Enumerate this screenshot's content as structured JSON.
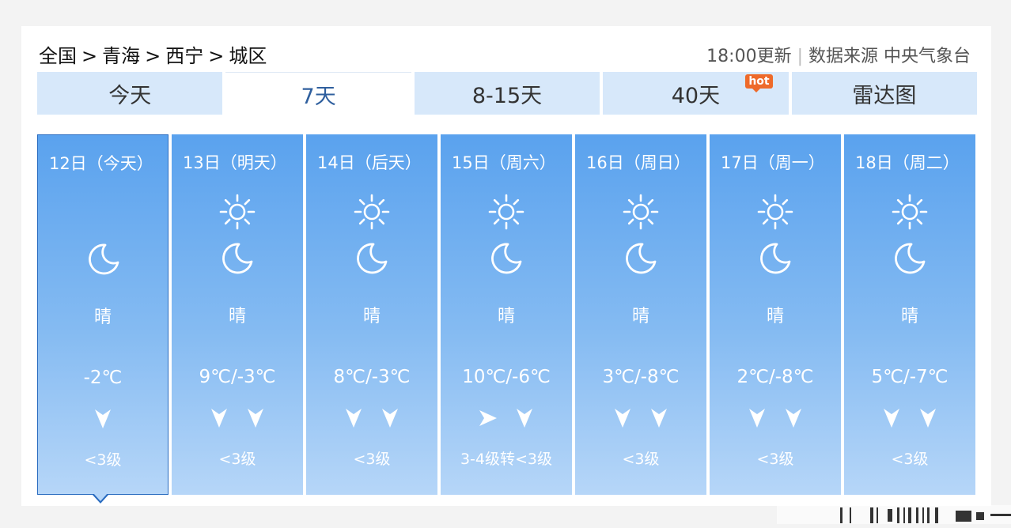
{
  "breadcrumb": {
    "items": [
      "全国",
      "青海",
      "西宁",
      "城区"
    ],
    "separator": ">"
  },
  "source": {
    "update_time": "18:00更新",
    "label": "数据来源 中央气象台"
  },
  "tabs": [
    {
      "label": "今天",
      "active": false
    },
    {
      "label": "7天",
      "active": true
    },
    {
      "label": "8-15天",
      "active": false
    },
    {
      "label": "40天",
      "active": false,
      "badge": "hot"
    },
    {
      "label": "雷达图",
      "active": false
    }
  ],
  "days": [
    {
      "date": "12日（今天）",
      "day_icon": null,
      "night_icon": "moon-icon",
      "condition": "晴",
      "temperature": "-2℃",
      "wind_dirs": [
        "down"
      ],
      "wind_level": "<3级",
      "selected": true
    },
    {
      "date": "13日（明天）",
      "day_icon": "sun-icon",
      "night_icon": "moon-icon",
      "condition": "晴",
      "temperature": "9℃/-3℃",
      "wind_dirs": [
        "down",
        "down"
      ],
      "wind_level": "<3级",
      "selected": false
    },
    {
      "date": "14日（后天）",
      "day_icon": "sun-icon",
      "night_icon": "moon-icon",
      "condition": "晴",
      "temperature": "8℃/-3℃",
      "wind_dirs": [
        "down",
        "down"
      ],
      "wind_level": "<3级",
      "selected": false
    },
    {
      "date": "15日（周六）",
      "day_icon": "sun-icon",
      "night_icon": "moon-icon",
      "condition": "晴",
      "temperature": "10℃/-6℃",
      "wind_dirs": [
        "right",
        "down"
      ],
      "wind_level": "3-4级转<3级",
      "selected": false
    },
    {
      "date": "16日（周日）",
      "day_icon": "sun-icon",
      "night_icon": "moon-icon",
      "condition": "晴",
      "temperature": "3℃/-8℃",
      "wind_dirs": [
        "down",
        "down"
      ],
      "wind_level": "<3级",
      "selected": false
    },
    {
      "date": "17日（周一）",
      "day_icon": "sun-icon",
      "night_icon": "moon-icon",
      "condition": "晴",
      "temperature": "2℃/-8℃",
      "wind_dirs": [
        "down",
        "down"
      ],
      "wind_level": "<3级",
      "selected": false
    },
    {
      "date": "18日（周二）",
      "day_icon": "sun-icon",
      "night_icon": "moon-icon",
      "condition": "晴",
      "temperature": "5℃/-7℃",
      "wind_dirs": [
        "down",
        "down"
      ],
      "wind_level": "<3级",
      "selected": false
    }
  ],
  "colors": {
    "tab_bg": "#d7e8fa",
    "tab_active_text": "#2f5f9e",
    "hot_badge": "#ee6a2a",
    "day_gradient_top": "#5aa2ee",
    "day_gradient_bottom": "#b6d6f8",
    "selected_border": "#2a6cc0"
  }
}
